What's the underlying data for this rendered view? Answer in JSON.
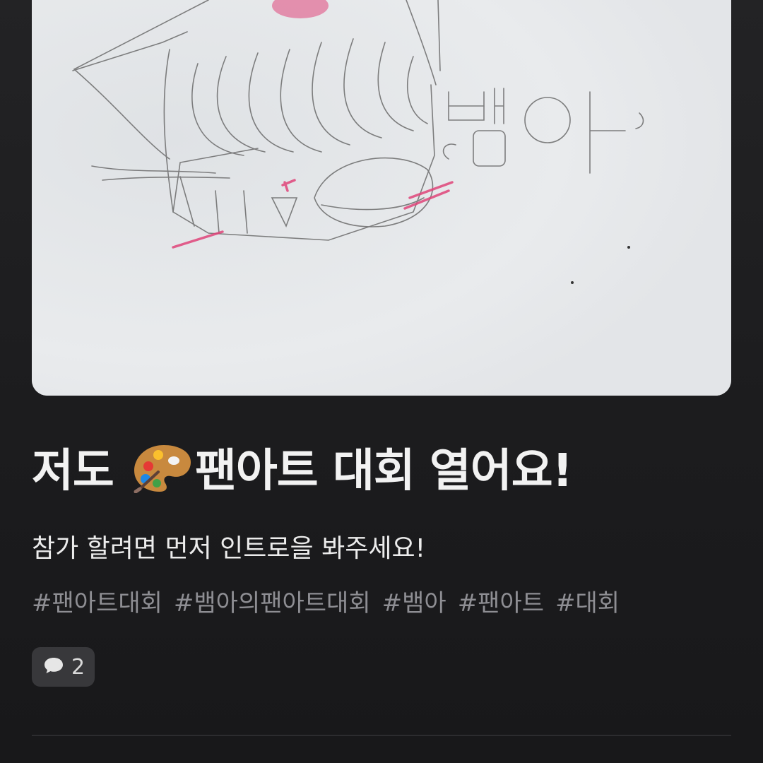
{
  "post": {
    "image": {
      "label": "뱀아",
      "colors": {
        "paper": "#e6e8ea",
        "pencil": "#6b6b6b",
        "pink": "#e0457a"
      }
    },
    "title_prefix": "저도",
    "title_icon": "artist-palette-icon",
    "title_suffix": "팬아트 대회 열어요!",
    "subtitle": "참가 할려면 먼저 인트로을 봐주세요!",
    "tags": [
      "#팬아트대회",
      "#뱀아의팬아트대회",
      "#뱀아",
      "#팬아트",
      "#대회"
    ],
    "comments": {
      "icon": "speech-bubble-icon",
      "count": "2"
    }
  },
  "colors": {
    "background": "#1c1c1e",
    "title": "#f2f2f2",
    "tag": "#8e8e93",
    "pill": "#38383b"
  }
}
